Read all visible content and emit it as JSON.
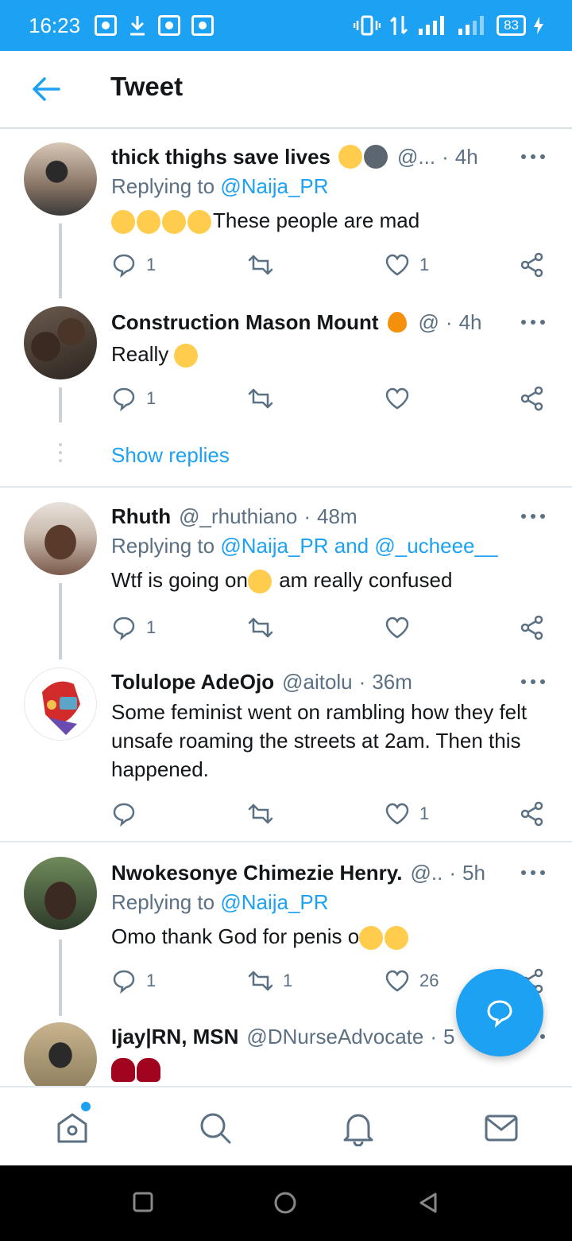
{
  "status_bar": {
    "time": "16:23",
    "battery": "83"
  },
  "header": {
    "title": "Tweet"
  },
  "tweets": [
    {
      "name": "thick thighs save lives",
      "handle": "@...",
      "time": "4h",
      "replying_prefix": "Replying to",
      "replying_to": "@Naija_PR",
      "text": "These people are mad",
      "reply_count": "1",
      "retweet_count": "",
      "like_count": "1"
    },
    {
      "name": "Construction Mason Mount",
      "handle": "@",
      "time": "4h",
      "text": "Really",
      "reply_count": "1",
      "retweet_count": "",
      "like_count": ""
    },
    {
      "name": "Rhuth",
      "handle": "@_rhuthiano",
      "time": "48m",
      "replying_prefix": "Replying to",
      "replying_to": "@Naija_PR and @_ucheee__",
      "text_before": "Wtf is going on",
      "text_after": " am really confused",
      "reply_count": "1",
      "retweet_count": "",
      "like_count": ""
    },
    {
      "name": "Tolulope AdeOjo",
      "handle": "@aitolu",
      "time": "36m",
      "text": "Some feminist went on rambling how they felt unsafe roaming the streets at 2am. Then this happened.",
      "reply_count": "",
      "retweet_count": "",
      "like_count": "1"
    },
    {
      "name": "Nwokesonye Chimezie Henry.",
      "handle": "@..",
      "time": "5h",
      "replying_prefix": "Replying to",
      "replying_to": "@Naija_PR",
      "text": "Omo thank God for penis o",
      "reply_count": "1",
      "retweet_count": "1",
      "like_count": "26"
    },
    {
      "name": "Ijay|RN, MSN",
      "handle": "@DNurseAdvocate",
      "time": "5"
    }
  ],
  "show_replies": "Show replies",
  "icons": {
    "back": "arrow-left-icon",
    "reply": "comment-icon",
    "retweet": "retweet-icon",
    "like": "heart-icon",
    "share": "share-icon",
    "compose": "compose-reply-icon",
    "nav": [
      "home-icon",
      "search-icon",
      "bell-icon",
      "mail-icon"
    ]
  },
  "colors": {
    "accent": "#1da1f2",
    "secondary_text": "#5b7083"
  }
}
